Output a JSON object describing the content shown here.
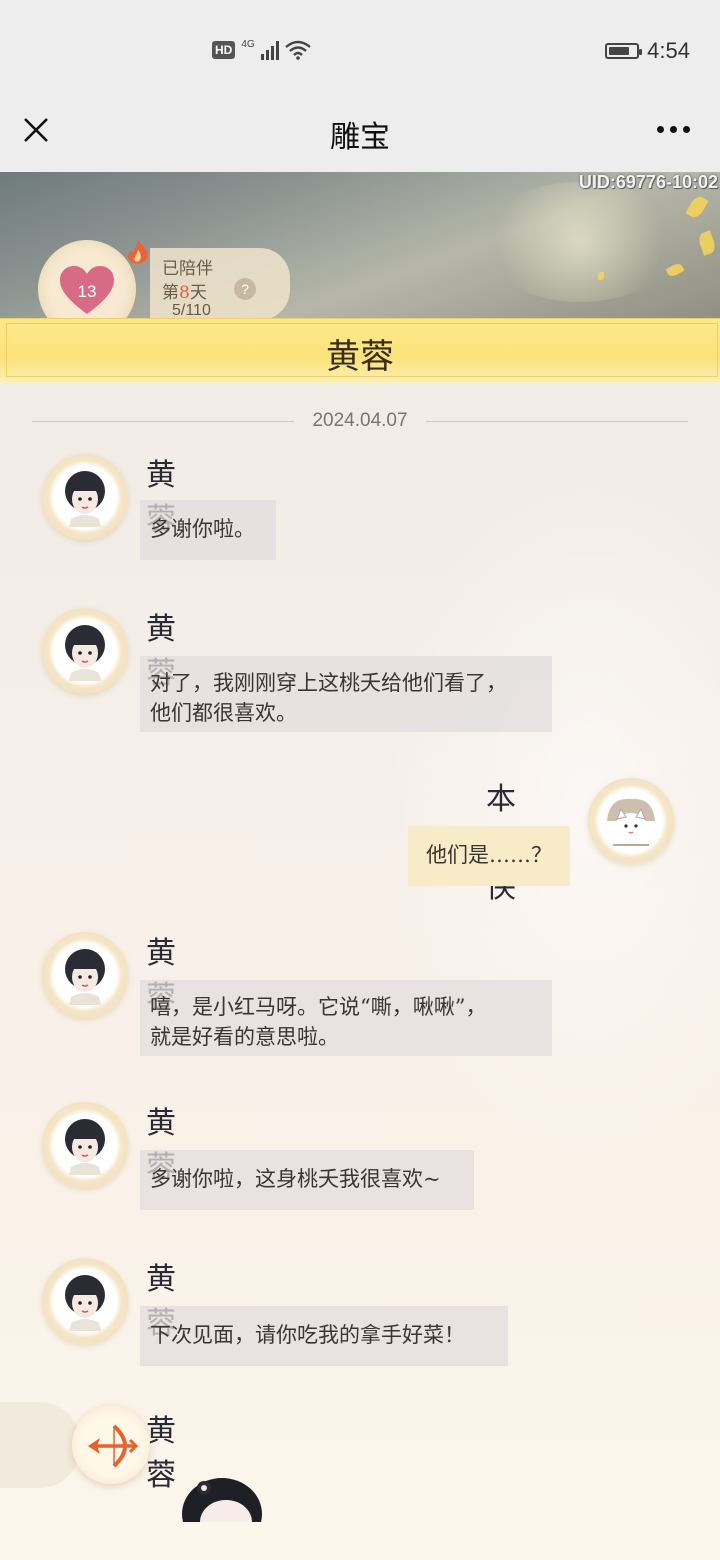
{
  "status_bar": {
    "hd_badge": "HD",
    "network": "4G",
    "time": "4:54",
    "battery_level": 0.75
  },
  "title_bar": {
    "title": "雕宝",
    "close_icon": "close-icon",
    "more_icon": "more-icon"
  },
  "banner": {
    "uid": "UID:69776-10:02",
    "intimacy_level": "13",
    "accompany_label": "已陪伴",
    "accompany_day_prefix": "第",
    "accompany_day_num": "8",
    "accompany_day_suffix": "天",
    "progress": "5/110",
    "help": "?"
  },
  "chat_header": {
    "name": "黄蓉"
  },
  "chat": {
    "date": "2024.04.07",
    "messages": [
      {
        "sender": "黄蓉",
        "text": "多谢你啦。"
      },
      {
        "sender": "黄蓉",
        "line1": "对了，我刚刚穿上这桃夭给他们看了，",
        "line2": "他们都很喜欢。"
      },
      {
        "sender": "本大侠",
        "text": "他们是……？"
      },
      {
        "sender": "黄蓉",
        "line1": "嘻，是小红马呀。它说“嘶，啾啾”，",
        "line2": "就是好看的意思啦。"
      },
      {
        "sender": "黄蓉",
        "text": "多谢你啦，这身桃夭我很喜欢~"
      },
      {
        "sender": "黄蓉",
        "text": "下次见面，请你吃我的拿手好菜！"
      },
      {
        "sender": "黄蓉"
      }
    ]
  },
  "colors": {
    "header_yellow": "#fbe27a",
    "bubble_other": "#e2dcde",
    "bubble_me": "#f8ebc8",
    "accent_orange": "#e85a3a"
  }
}
